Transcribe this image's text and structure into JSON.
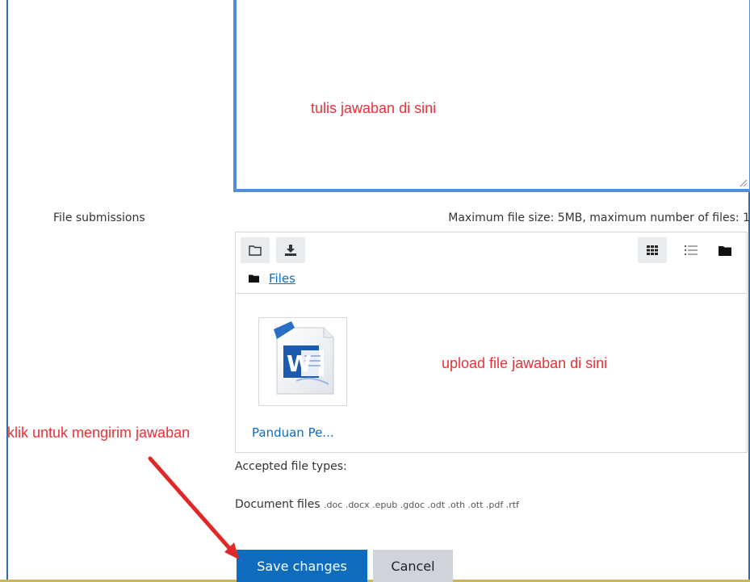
{
  "annotations": {
    "write_here": "tulis jawaban di sini",
    "upload_here": "upload file jawaban di sini",
    "click_to_send": "klik untuk mengirim jawaban",
    "color": "#e8313a"
  },
  "form": {
    "file_submissions_label": "File submissions",
    "max_info": "Maximum file size: 5MB, maximum number of files: 1"
  },
  "filemanager": {
    "toolbar_icons": [
      "folder-icon",
      "download-icon",
      "grid-view-icon",
      "list-view-icon",
      "tree-view-icon"
    ],
    "breadcrumb": "Files",
    "file": {
      "name": "Panduan Pe...",
      "icon": "word-document-icon"
    }
  },
  "accepted": {
    "label": "Accepted file types:",
    "group": "Document files",
    "extensions": ".doc .docx .epub .gdoc .odt .oth .ott .pdf .rtf"
  },
  "buttons": {
    "save": "Save changes",
    "cancel": "Cancel"
  },
  "colors": {
    "primary": "#0f6cbf",
    "editor_border": "#4f90d8",
    "annotation": "#e8313a"
  }
}
